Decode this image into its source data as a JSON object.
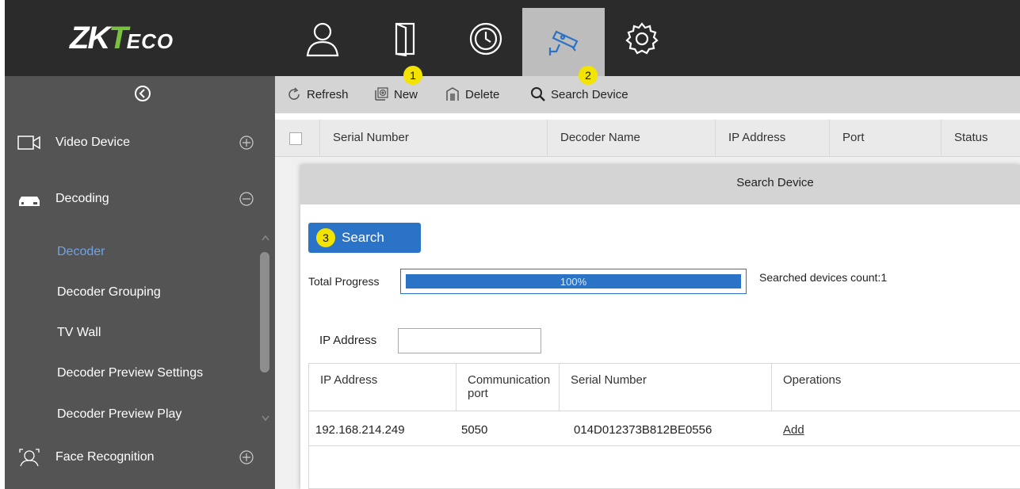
{
  "brand": {
    "logo_zk": "ZK",
    "logo_t": "T",
    "logo_eco": "ECO"
  },
  "top_nav": [
    {
      "name": "personnel",
      "icon": "user-icon"
    },
    {
      "name": "access",
      "icon": "door-icon"
    },
    {
      "name": "attendance",
      "icon": "clock-icon"
    },
    {
      "name": "video",
      "icon": "camera-icon",
      "active": true
    },
    {
      "name": "system",
      "icon": "gear-icon"
    }
  ],
  "sidebar": {
    "sections": [
      {
        "label": "Video Device",
        "toggle": "plus"
      },
      {
        "label": "Decoding",
        "toggle": "minus"
      },
      {
        "label": "Face Recognition",
        "toggle": "plus"
      }
    ],
    "sub_items": [
      {
        "label": "Decoder",
        "active": true
      },
      {
        "label": "Decoder Grouping"
      },
      {
        "label": "TV Wall"
      },
      {
        "label": "Decoder Preview Settings"
      },
      {
        "label": "Decoder Preview Play"
      }
    ]
  },
  "toolbar": {
    "refresh": "Refresh",
    "new": "New",
    "delete": "Delete",
    "search_device": "Search Device",
    "badge_new": "1",
    "badge_search": "2"
  },
  "grid": {
    "columns": [
      "Serial Number",
      "Decoder Name",
      "IP Address",
      "Port",
      "Status"
    ]
  },
  "dialog": {
    "title": "Search Device",
    "search_button": "Search",
    "badge_search": "3",
    "progress_label": "Total Progress",
    "progress_value": 1.0,
    "progress_text": "100%",
    "count_label": "Searched devices count:1",
    "ip_filter_label": "IP Address",
    "ip_filter_value": "",
    "columns": [
      "IP Address",
      "Communication port",
      "Serial Number",
      "Operations"
    ],
    "rows": [
      {
        "ip": "192.168.214.249",
        "port": "5050",
        "serial": "014D012373B812BE0556",
        "op": "Add"
      }
    ]
  },
  "colors": {
    "accent": "#2a73c6",
    "badge": "#f2e300",
    "sidebar": "#545454",
    "topbar": "#2b2b2b",
    "active_link": "#6fa3e6"
  }
}
